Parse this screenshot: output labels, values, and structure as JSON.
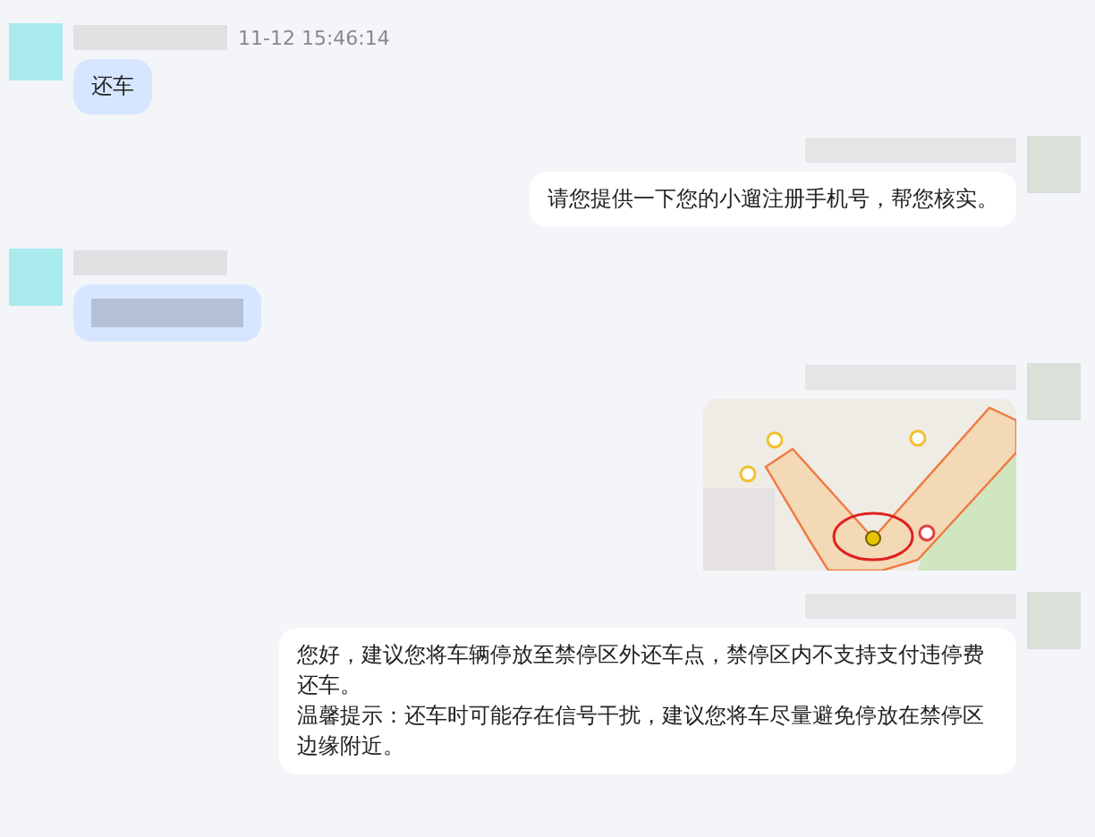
{
  "messages": [
    {
      "outgoing": false,
      "time": "11-12 15:46:14",
      "kind": "text",
      "paragraphs": [
        "还车"
      ]
    },
    {
      "outgoing": true,
      "kind": "text",
      "paragraphs": [
        "请您提供一下您的小遛注册手机号，帮您核实。"
      ]
    },
    {
      "outgoing": false,
      "kind": "redacted"
    },
    {
      "outgoing": true,
      "kind": "image"
    },
    {
      "outgoing": true,
      "kind": "text",
      "paragraphs": [
        "您好，建议您将车辆停放至禁停区外还车点，禁停区内不支持支付违停费还车。",
        "温馨提示：还车时可能存在信号干扰，建议您将车尽量避免停放在禁停区边缘附近。"
      ]
    }
  ]
}
